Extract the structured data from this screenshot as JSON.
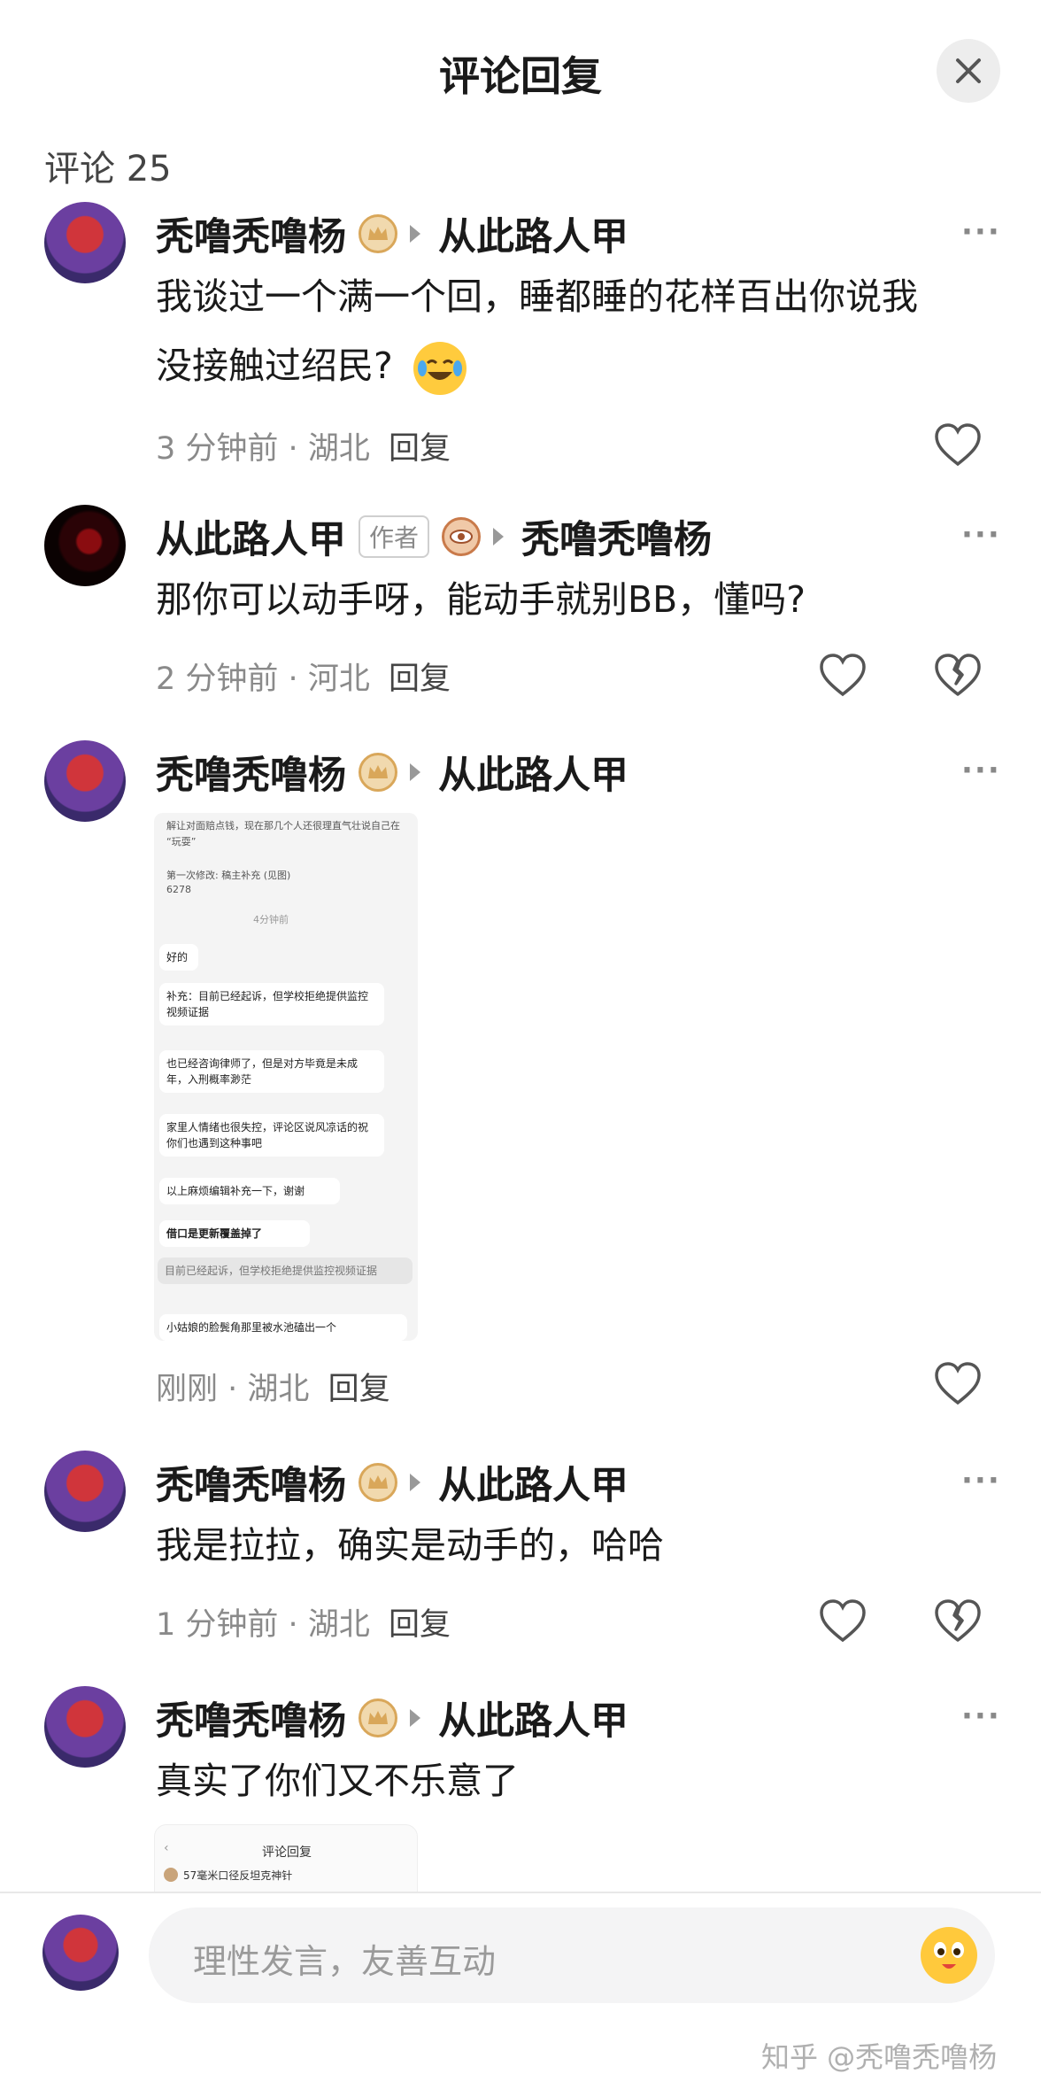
{
  "header": {
    "title": "评论回复",
    "close_icon": "close-icon"
  },
  "count_label": "评论 25",
  "comments": [
    {
      "author": "秃噜秃噜杨",
      "badge": "crown-badge-icon",
      "reply_to": "从此路人甲",
      "text_line1": "我谈过一个满一个回，睡都睡的花样百出你说我",
      "text_line2": "没接触过绍民?",
      "emoji": "laughing-crying-emoji",
      "time": "3 分钟前",
      "location": "湖北",
      "reply_label": "回复"
    },
    {
      "author": "从此路人甲",
      "author_tag": "作者",
      "badge": "eye-badge-icon",
      "reply_to": "秃噜秃噜杨",
      "text": "那你可以动手呀，能动手就别BB，懂吗?",
      "time": "2 分钟前",
      "location": "河北",
      "reply_label": "回复"
    },
    {
      "author": "秃噜秃噜杨",
      "badge": "crown-badge-icon",
      "reply_to": "从此路人甲",
      "time": "刚刚",
      "location": "湖北",
      "reply_label": "回复",
      "screenshot": {
        "line1": "解让对面赔点钱，现在那几个人还很理直气壮说自己在",
        "line2": "“玩耍”",
        "edit_note": "第一次修改: 稿主补充 (见图)",
        "edit_num": "6278",
        "time_divider": "4分钟前",
        "bubbles": [
          "好的",
          "补充：目前已经起诉，但学校拒绝提供监控视频证据",
          "也已经咨询律师了，但是对方毕竟是未成年，入刑概率渺茫",
          "家里人情绪也很失控，评论区说风凉话的祝你们也遇到这种事吧",
          "以上麻烦编辑补充一下，谢谢",
          "借口是更新覆盖掉了"
        ],
        "quote": "目前已经起诉，但学校拒绝提供监控视频证据",
        "last_line": "小姑娘的脸鬓角那里被水池磕出一个"
      }
    },
    {
      "author": "秃噜秃噜杨",
      "badge": "crown-badge-icon",
      "reply_to": "从此路人甲",
      "text": "我是拉拉，确实是动手的，哈哈",
      "time": "1 分钟前",
      "location": "湖北",
      "reply_label": "回复"
    },
    {
      "author": "秃噜秃噜杨",
      "badge": "crown-badge-icon",
      "reply_to": "从此路人甲",
      "text": "真实了你们又不乐意了",
      "thumb": {
        "title": "评论回复",
        "line": "57毫米口径反坦克神针"
      }
    }
  ],
  "input": {
    "placeholder": "理性发言，友善互动"
  },
  "watermark": "知乎 @秃噜秃噜杨",
  "colors": {
    "badge_gold": "#d9a75a",
    "secondary_text": "#8a8a8a"
  }
}
